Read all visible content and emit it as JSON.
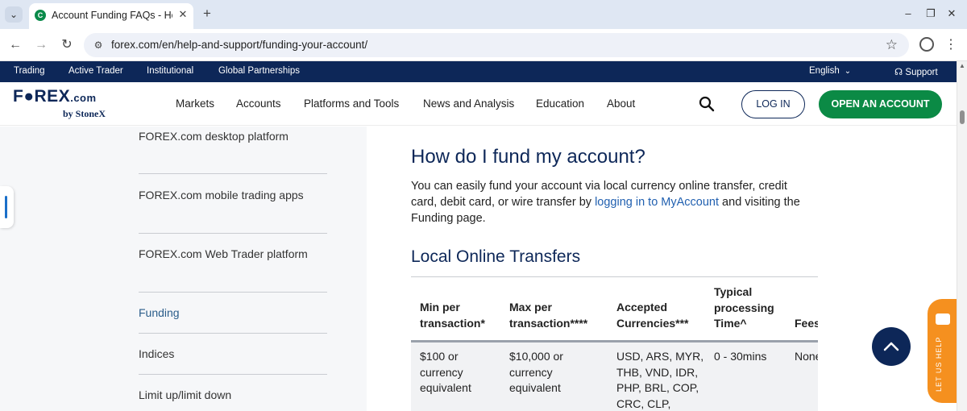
{
  "browser": {
    "tab_title": "Account Funding FAQs - Help and Support",
    "url": "forex.com/en/help-and-support/funding-your-account/"
  },
  "topbar": {
    "links": [
      "Trading",
      "Active Trader",
      "Institutional",
      "Global Partnerships"
    ],
    "language": "English",
    "support": "Support"
  },
  "header": {
    "logo_main": "F●REX",
    "logo_dotcom": ".com",
    "logo_sub": "by StoneX",
    "menu": [
      "Markets",
      "Accounts",
      "Platforms and Tools",
      "News and Analysis",
      "Education",
      "About"
    ],
    "login": "LOG IN",
    "open_account": "OPEN AN ACCOUNT"
  },
  "sidebar": {
    "items": [
      {
        "label": "FOREX.com desktop platform",
        "active": false
      },
      {
        "label": "FOREX.com mobile trading apps",
        "active": false
      },
      {
        "label": "FOREX.com Web Trader platform",
        "active": false
      },
      {
        "label": "Funding",
        "active": true
      },
      {
        "label": "Indices",
        "active": false
      },
      {
        "label": "Limit up/limit down",
        "active": false
      }
    ]
  },
  "main": {
    "heading": "How do I fund my account?",
    "para_before": "You can easily fund your account via local currency online transfer, credit card, debit card, or wire transfer by ",
    "para_link": "logging in to MyAccount",
    "para_after": " and visiting the Funding page.",
    "subheading": "Local Online Transfers",
    "table": {
      "headers": [
        "Min per transaction*",
        "Max per transaction****",
        "Accepted Currencies***",
        "Typical processing Time^",
        "Fees"
      ],
      "row": [
        "$100 or currency equivalent",
        "$10,000 or currency equivalent",
        "USD, ARS, MYR, THB, VND, IDR, PHP, BRL, COP, CRC, CLP,",
        "0 - 30mins",
        "None"
      ]
    }
  },
  "widgets": {
    "help_label": "LET US HELP"
  },
  "colors": {
    "navy": "#0d2758",
    "green": "#0b8a45",
    "orange": "#f5901f",
    "link": "#2160b0"
  }
}
